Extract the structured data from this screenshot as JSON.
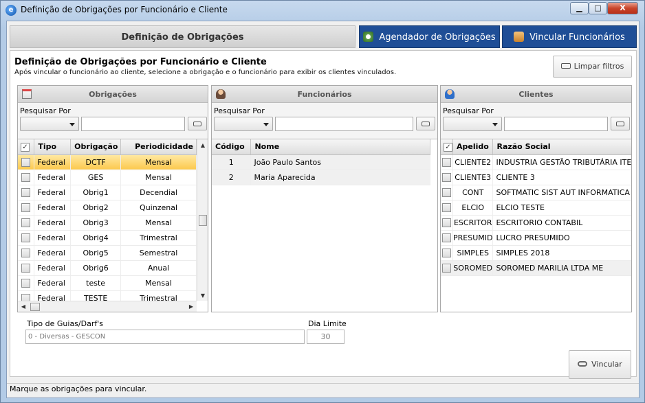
{
  "window": {
    "title": "Definição de Obrigações por Funcionário e Cliente",
    "minimize": "▁",
    "maximize": "□",
    "close": "X"
  },
  "tabs": [
    {
      "label": "Definição de Obrigações"
    },
    {
      "label": "Agendador de Obrigações"
    },
    {
      "label": "Vincular Funcionários"
    }
  ],
  "header": {
    "title": "Definição de Obrigações por Funcionário e Cliente",
    "subtitle": "Após vincular o funcionário ao cliente, selecione a obrigação e o funcionário para exibir os clientes vinculados.",
    "clear_button": "Limpar filtros"
  },
  "search_label": "Pesquisar Por",
  "obrigacoes": {
    "title": "Obrigações",
    "columns": [
      "Tipo",
      "Obrigação",
      "Periodicidade"
    ],
    "rows": [
      {
        "tipo": "Federal",
        "obrigacao": "DCTF",
        "periodicidade": "Mensal"
      },
      {
        "tipo": "Federal",
        "obrigacao": "GES",
        "periodicidade": "Mensal"
      },
      {
        "tipo": "Federal",
        "obrigacao": "Obrig1",
        "periodicidade": "Decendial"
      },
      {
        "tipo": "Federal",
        "obrigacao": "Obrig2",
        "periodicidade": "Quinzenal"
      },
      {
        "tipo": "Federal",
        "obrigacao": "Obrig3",
        "periodicidade": "Mensal"
      },
      {
        "tipo": "Federal",
        "obrigacao": "Obrig4",
        "periodicidade": "Trimestral"
      },
      {
        "tipo": "Federal",
        "obrigacao": "Obrig5",
        "periodicidade": "Semestral"
      },
      {
        "tipo": "Federal",
        "obrigacao": "Obrig6",
        "periodicidade": "Anual"
      },
      {
        "tipo": "Federal",
        "obrigacao": "teste",
        "periodicidade": "Mensal"
      },
      {
        "tipo": "Federal",
        "obrigacao": "TESTE",
        "periodicidade": "Trimestral"
      }
    ]
  },
  "funcionarios": {
    "title": "Funcionários",
    "columns": [
      "Código",
      "Nome"
    ],
    "rows": [
      {
        "codigo": "1",
        "nome": "João Paulo Santos"
      },
      {
        "codigo": "2",
        "nome": "Maria Aparecida"
      }
    ]
  },
  "clientes": {
    "title": "Clientes",
    "columns": [
      "Apelido",
      "Razão Social"
    ],
    "rows": [
      {
        "apelido": "CLIENTE2",
        "razao": "INDUSTRIA GESTÃO TRIBUTÁRIA ITE"
      },
      {
        "apelido": "CLIENTE3",
        "razao": "CLIENTE 3"
      },
      {
        "apelido": "CONT",
        "razao": "SOFTMATIC SIST AUT INFORMATICA"
      },
      {
        "apelido": "ELCIO",
        "razao": "ELCIO TESTE"
      },
      {
        "apelido": "ESCRITOR",
        "razao": "ESCRITORIO CONTABIL"
      },
      {
        "apelido": "PRESUMID",
        "razao": "LUCRO PRESUMIDO"
      },
      {
        "apelido": "SIMPLES",
        "razao": "SIMPLES 2018"
      },
      {
        "apelido": "SOROMED",
        "razao": "SOROMED MARILIA LTDA ME"
      }
    ]
  },
  "guias": {
    "label": "Tipo de Guias/Darf's",
    "value": "0 - Diversas - GESCON"
  },
  "dia_limite": {
    "label": "Dia Limite",
    "value": "30"
  },
  "vincular_button": "Vincular",
  "status": "Marque as obrigações para vincular."
}
